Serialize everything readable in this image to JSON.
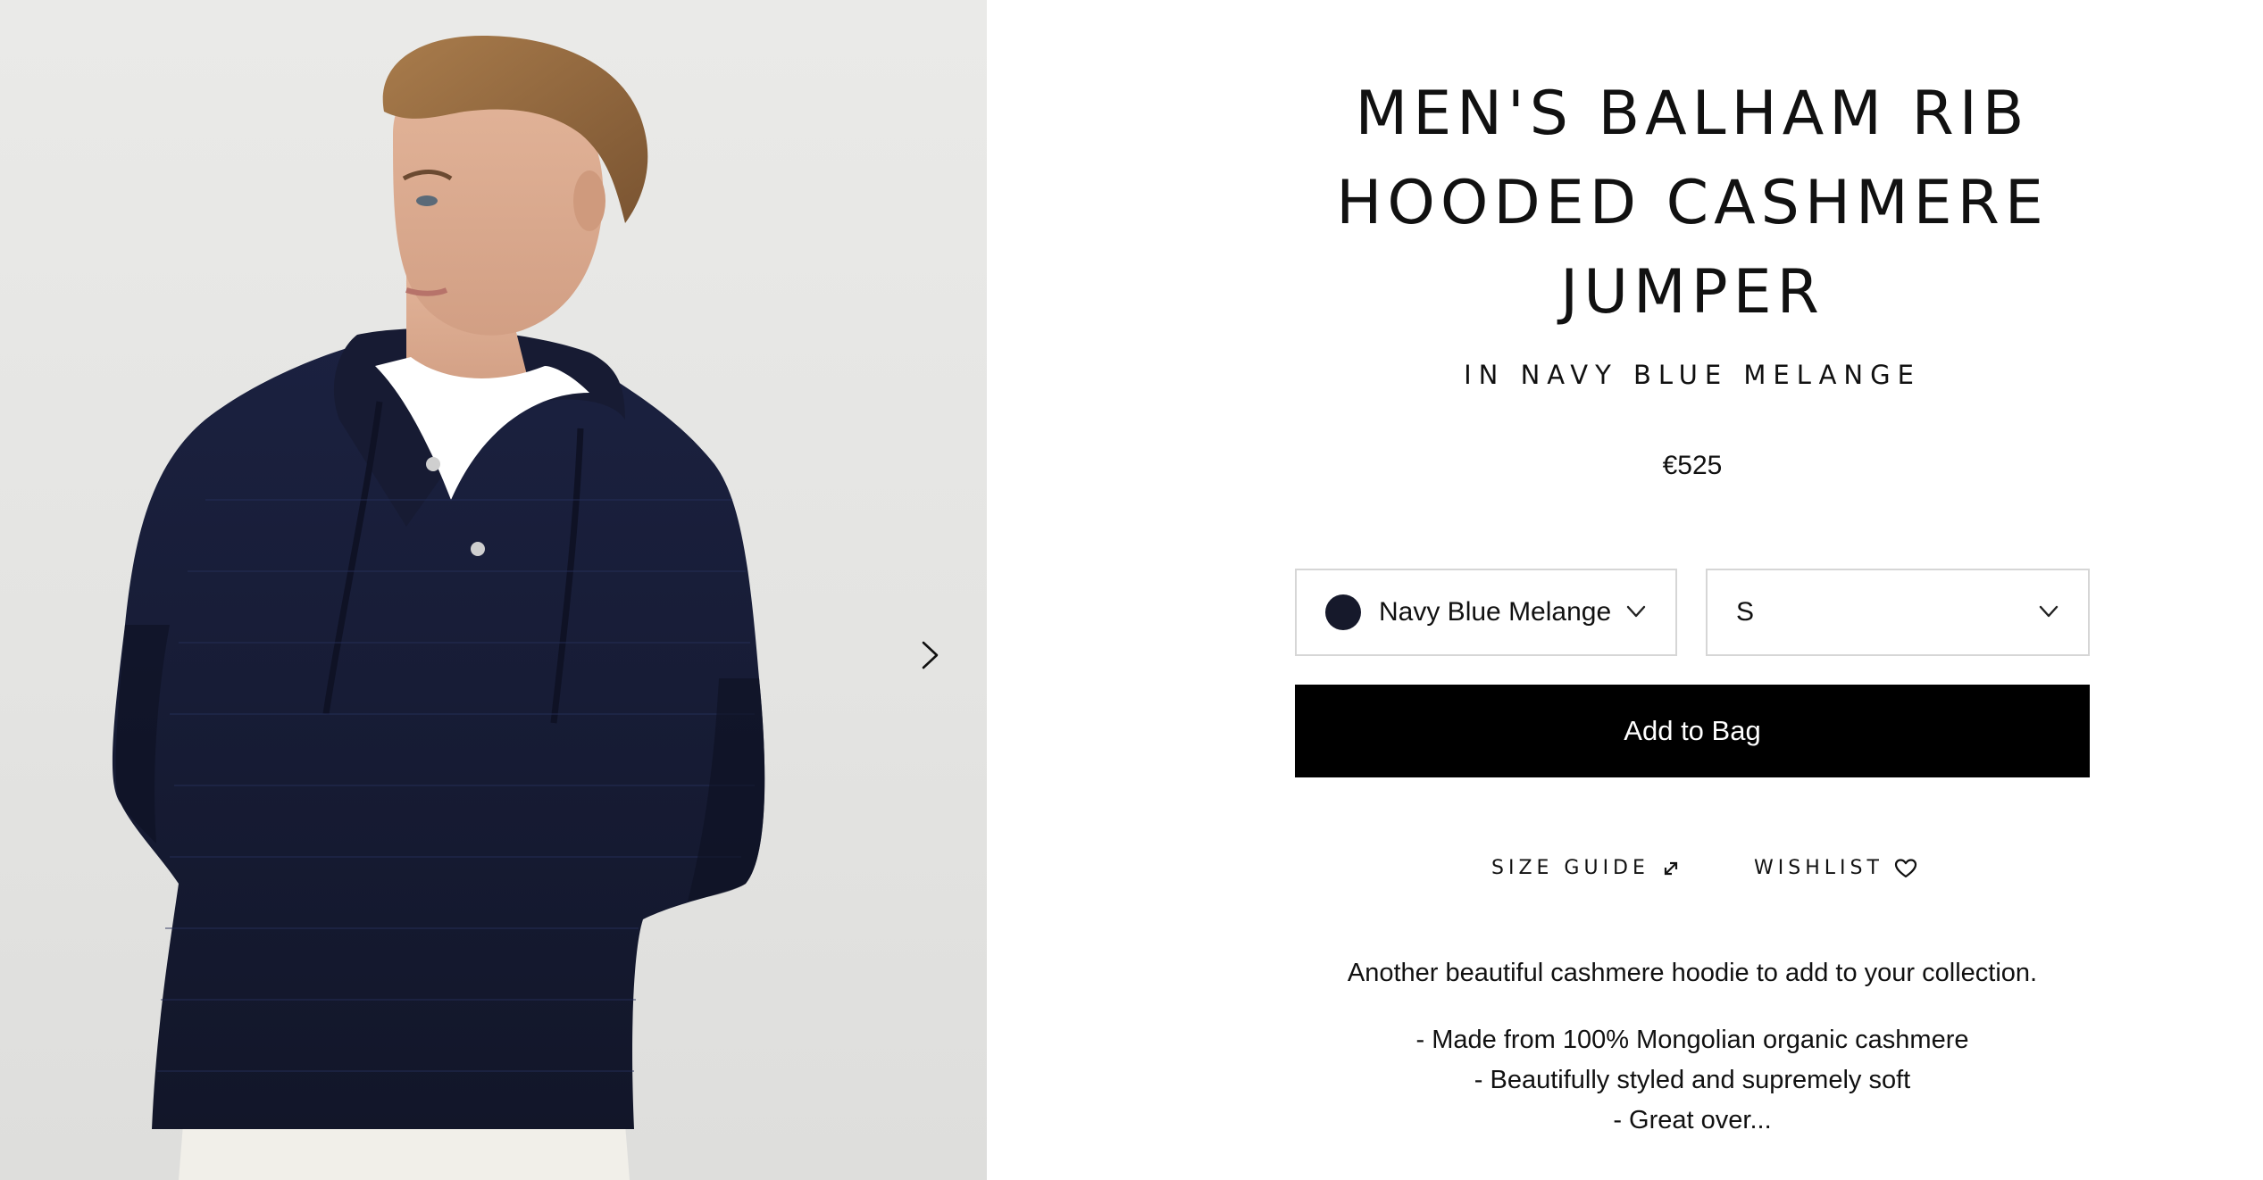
{
  "product": {
    "title": "MEN'S BALHAM RIB HOODED CASHMERE JUMPER",
    "colour_line": "IN NAVY BLUE MELANGE",
    "price": "€525"
  },
  "options": {
    "colour": {
      "selected": "Navy Blue Melange",
      "swatch_color": "#16192b"
    },
    "size": {
      "selected": "S"
    }
  },
  "actions": {
    "add_to_bag": "Add to Bag",
    "size_guide": "SIZE GUIDE",
    "wishlist": "WISHLIST"
  },
  "description": {
    "lead": "Another beautiful cashmere hoodie to add to your collection.",
    "bullets": [
      "- Made from 100% Mongolian organic cashmere",
      "- Beautifully styled and supremely soft",
      "- Great over..."
    ]
  },
  "gallery": {
    "image_alt_icon": "product-photo",
    "next_icon": "chevron-right-icon"
  },
  "colors": {
    "primary_button": "#000000",
    "background": "#ffffff",
    "border": "#d6d6d6"
  }
}
